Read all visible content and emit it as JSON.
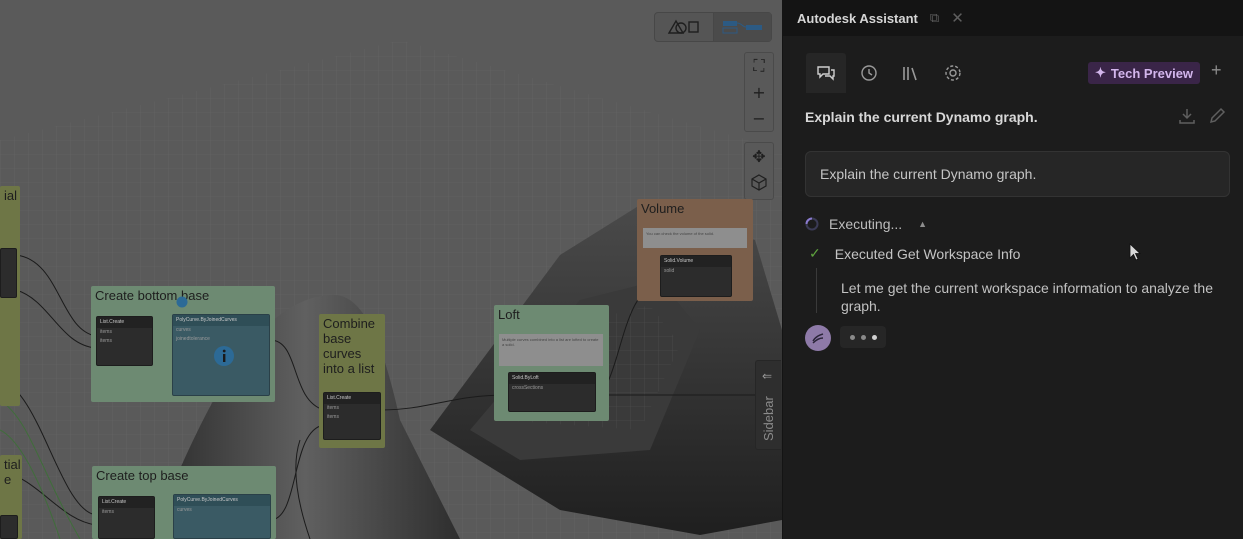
{
  "canvas": {
    "groups": {
      "partial_left_top": "ial",
      "create_bottom_base": "Create bottom base",
      "combine": "Combine base curves into a list",
      "loft": "Loft",
      "volume": "Volume",
      "partial_left_bottom_1": "tial",
      "partial_left_bottom_2": "e",
      "create_top_base": "Create top base"
    },
    "nodes": {
      "list_create": "List.Create",
      "polycurve": "PolyCurve.ByJoinedCurves",
      "solid_byloft": "Solid.ByLoft",
      "solid_volume": "Solid.Volume",
      "port_items": "items",
      "port_list": "list",
      "port_curves": "curves",
      "port_joinedtol": "joinedtolerance",
      "port_crossections": "crossSections",
      "port_solid": "solid",
      "port_polycurve": "polycurve",
      "port_double": "double"
    },
    "notes": {
      "loft": "Multiple curves combined into a list are lofted to create a solid.",
      "volume": "You can check the volume of the solid."
    },
    "sidebar_label": "Sidebar"
  },
  "panel": {
    "title": "Autodesk Assistant",
    "tech_preview": "Tech Preview",
    "conversation_title": "Explain the current Dynamo graph.",
    "prompt": "Explain the current Dynamo graph.",
    "status": "Executing...",
    "step": "Executed Get Workspace Info",
    "thought": "Let me get the current workspace information to analyze the graph."
  },
  "colors": {
    "accent_purple": "#d3b6ec",
    "badge_bg": "#3a2548",
    "success_green": "#5ea33e"
  }
}
